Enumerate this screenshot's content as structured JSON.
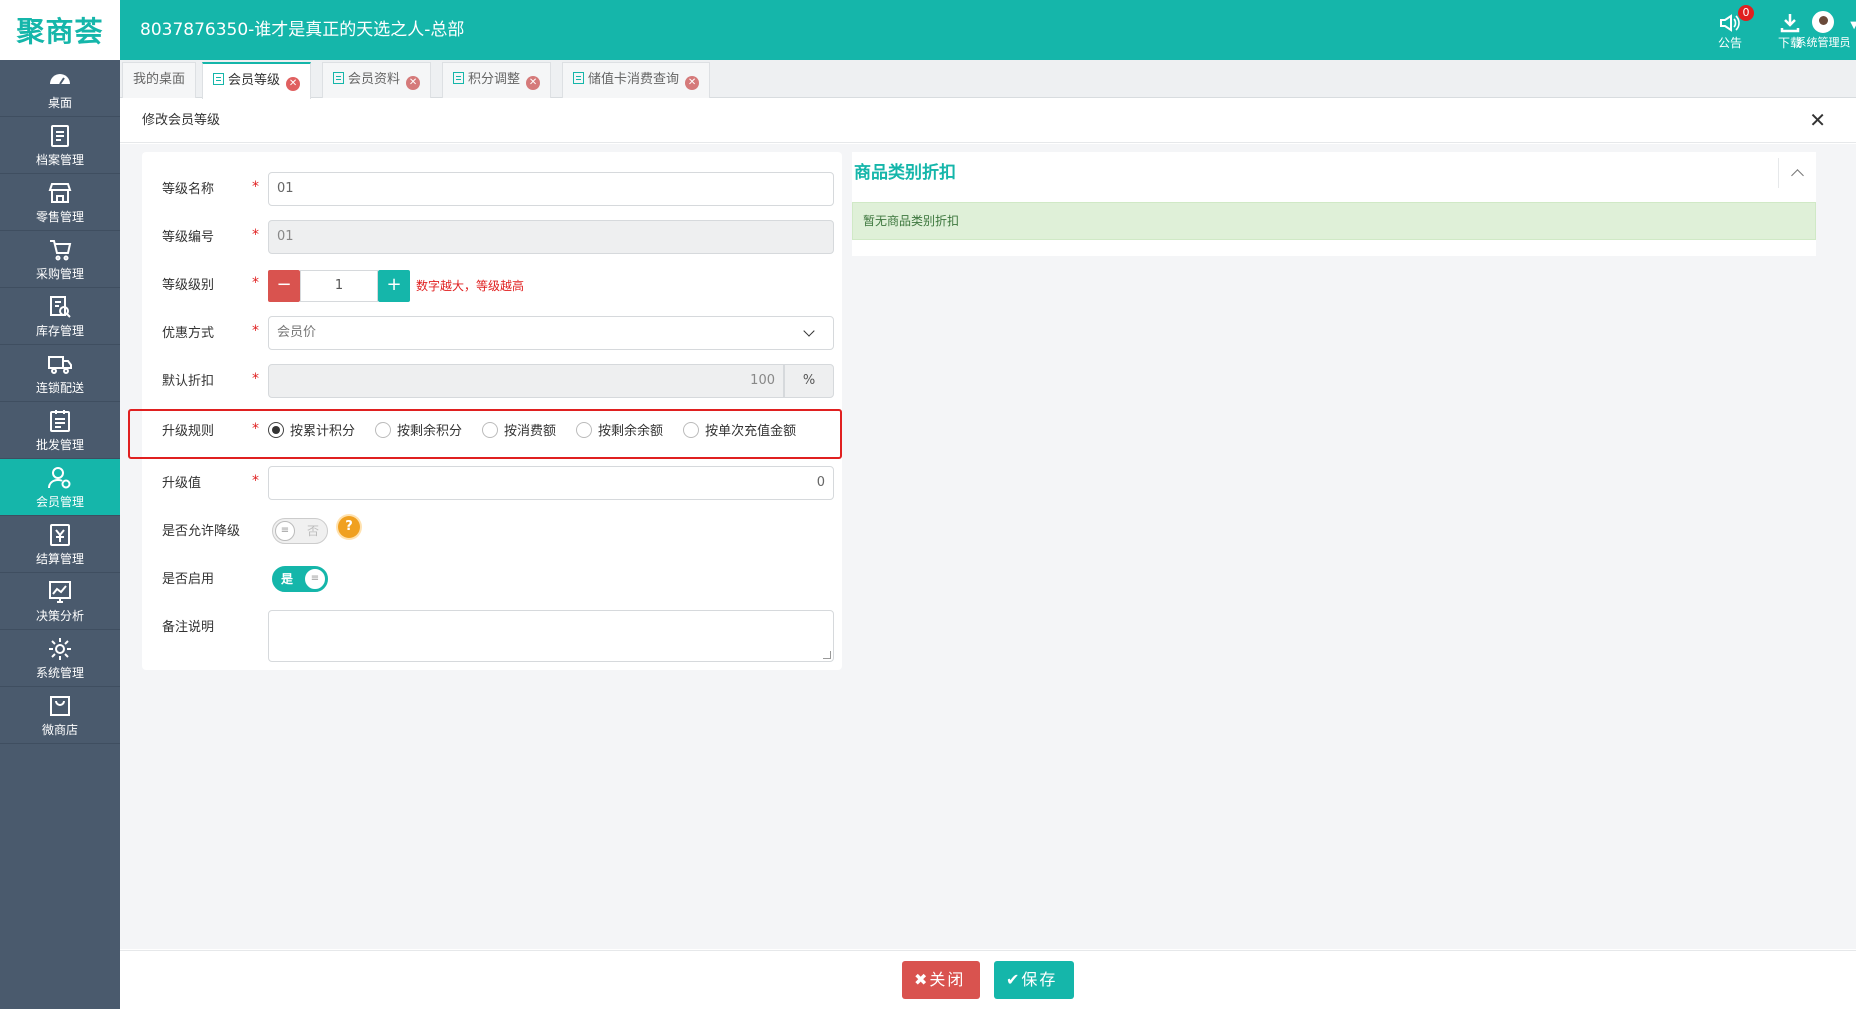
{
  "app": {
    "logo": "聚商荟",
    "title": "8037876350-谁才是真正的天选之人-总部"
  },
  "header": {
    "notice_label": "公告",
    "notice_count": "0",
    "download_label": "下载",
    "user_label": "系统管理员"
  },
  "sidebar": {
    "items": [
      {
        "label": "桌面",
        "icon": "dashboard-icon"
      },
      {
        "label": "档案管理",
        "icon": "archive-icon"
      },
      {
        "label": "零售管理",
        "icon": "store-icon"
      },
      {
        "label": "采购管理",
        "icon": "purchase-icon"
      },
      {
        "label": "库存管理",
        "icon": "inventory-icon"
      },
      {
        "label": "连锁配送",
        "icon": "truck-icon"
      },
      {
        "label": "批发管理",
        "icon": "wholesale-icon"
      },
      {
        "label": "会员管理",
        "icon": "member-icon"
      },
      {
        "label": "结算管理",
        "icon": "settlement-icon"
      },
      {
        "label": "决策分析",
        "icon": "chart-icon"
      },
      {
        "label": "系统管理",
        "icon": "gear-icon"
      },
      {
        "label": "微商店",
        "icon": "shop-bag-icon"
      }
    ],
    "active_index": 7
  },
  "tabs": [
    {
      "label": "我的桌面"
    },
    {
      "label": "会员等级"
    },
    {
      "label": "会员资料"
    },
    {
      "label": "积分调整"
    },
    {
      "label": "储值卡消费查询"
    }
  ],
  "panel": {
    "title": "修改会员等级",
    "close_glyph": "✕"
  },
  "form": {
    "name_label": "等级名称",
    "name_value": "01",
    "code_label": "等级编号",
    "code_value": "01",
    "level_label": "等级级别",
    "level_value": "1",
    "level_hint": "数字越大，等级越高",
    "discount_type_label": "优惠方式",
    "discount_type_value": "会员价",
    "default_discount_label": "默认折扣",
    "default_discount_value": "100",
    "percent_unit": "%",
    "upgrade_rule_label": "升级规则",
    "upgrade_rules": [
      "按累计积分",
      "按剩余积分",
      "按消费额",
      "按剩余余额",
      "按单次充值金额"
    ],
    "upgrade_rule_selected": 0,
    "upgrade_value_label": "升级值",
    "upgrade_value": "0",
    "allow_downgrade_label": "是否允许降级",
    "allow_downgrade_state": "否",
    "enabled_label": "是否启用",
    "enabled_state": "是",
    "remark_label": "备注说明",
    "required_mark": "*"
  },
  "category_discount": {
    "title": "商品类别折扣",
    "empty_message": "暂无商品类别折扣"
  },
  "footer": {
    "close_label": "关闭",
    "save_label": "保存"
  },
  "colors": {
    "brand": "#15b6aa",
    "danger": "#d9534f",
    "sidebar_bg": "#4a5a6d"
  }
}
